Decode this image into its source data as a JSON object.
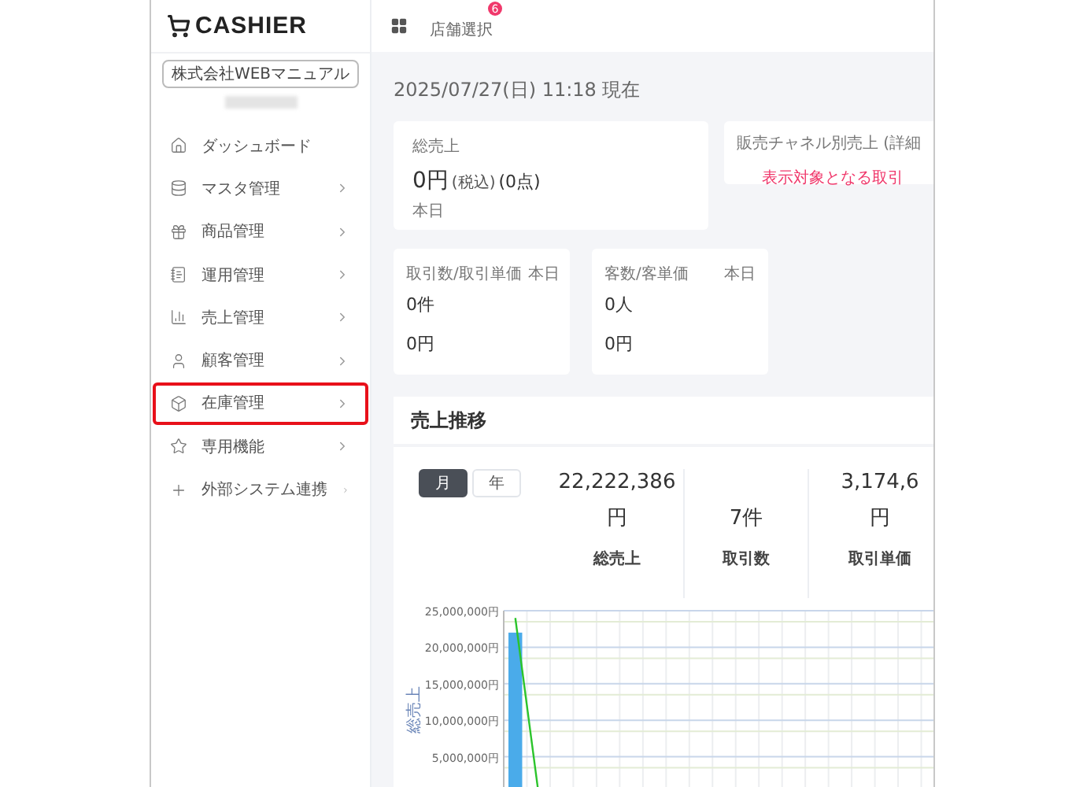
{
  "sidebar": {
    "logo": "CASHIER",
    "company": "株式会社WEBマニュアル",
    "items": [
      {
        "label": "ダッシュボード",
        "has_children": false,
        "highlighted": false
      },
      {
        "label": "マスタ管理",
        "has_children": true,
        "highlighted": false
      },
      {
        "label": "商品管理",
        "has_children": true,
        "highlighted": false
      },
      {
        "label": "運用管理",
        "has_children": true,
        "highlighted": false
      },
      {
        "label": "売上管理",
        "has_children": true,
        "highlighted": false
      },
      {
        "label": "顧客管理",
        "has_children": true,
        "highlighted": false
      },
      {
        "label": "在庫管理",
        "has_children": true,
        "highlighted": true
      },
      {
        "label": "専用機能",
        "has_children": true,
        "highlighted": false
      },
      {
        "label": "外部システム連携",
        "has_children": true,
        "highlighted": false
      }
    ]
  },
  "header": {
    "store_select": "店舗選択",
    "badge": "6"
  },
  "date_line": "2025/07/27(日) 11:18 現在",
  "total_sales": {
    "title": "総売上",
    "amount": "0円",
    "tax": "(税込)",
    "count": "(0点)",
    "period": "本日"
  },
  "channel_sales": {
    "title": "販売チャネル別売上 (詳細",
    "message": "表示対象となる取引"
  },
  "small_cards": [
    {
      "title": "取引数/取引単価",
      "period": "本日",
      "value_1": "0件",
      "value_2": "0円"
    },
    {
      "title": "客数/客単価",
      "period": "本日",
      "value_1": "0人",
      "value_2": "0円"
    }
  ],
  "trend": {
    "title": "売上推移",
    "toggle": [
      {
        "label": "月",
        "selected": true
      },
      {
        "label": "年",
        "selected": false
      }
    ],
    "stats": [
      {
        "value": "22,222,386",
        "unit": "円",
        "label": "総売上"
      },
      {
        "value": "7件",
        "label": "取引数"
      },
      {
        "value": "3,174,6",
        "unit": "円",
        "label": "取引単価"
      }
    ],
    "chart_data": {
      "type": "bar",
      "ylabel": "総売上",
      "grid": true,
      "series": [
        {
          "type": "bar",
          "color": "#4aabea",
          "values": [
            22000000,
            null,
            null,
            null,
            null,
            null,
            null,
            null,
            null,
            null,
            null,
            null,
            null,
            null,
            null,
            null,
            null,
            null,
            null
          ]
        },
        {
          "type": "line",
          "color": "#2bc42b",
          "values": [
            24000000,
            0,
            null,
            null,
            null,
            null,
            null,
            null,
            null,
            null,
            null,
            null,
            null,
            null,
            null,
            null,
            null,
            null,
            null
          ]
        }
      ],
      "ylim": [
        0,
        25000000
      ],
      "yticks": [
        {
          "value": 5000000,
          "label": "5,000,000円"
        },
        {
          "value": 10000000,
          "label": "10,000,000円"
        },
        {
          "value": 15000000,
          "label": "15,000,000円"
        },
        {
          "value": 20000000,
          "label": "20,000,000円"
        },
        {
          "value": 25000000,
          "label": "25,000,000円"
        }
      ]
    }
  }
}
